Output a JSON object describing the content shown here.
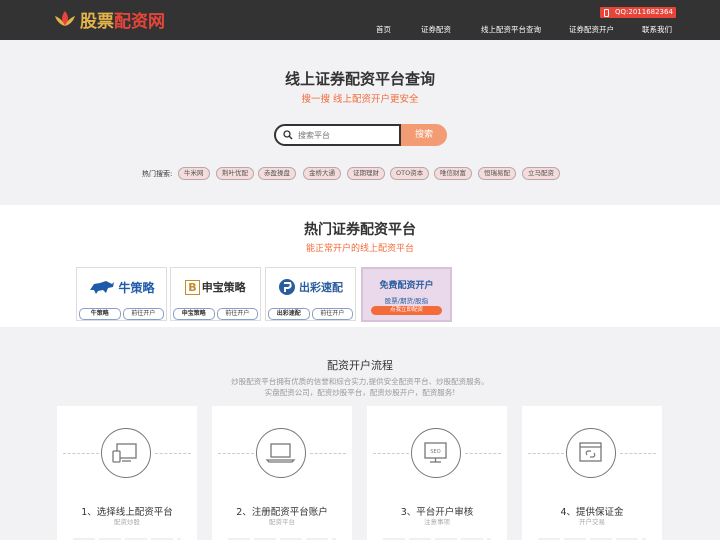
{
  "header": {
    "logo_text_a": "股票",
    "logo_text_b": "配资网",
    "phone": "QQ:2011682364",
    "nav": [
      {
        "label": "首页"
      },
      {
        "label": "证券配资"
      },
      {
        "label": "线上配资平台查询"
      },
      {
        "label": "证券配资开户"
      },
      {
        "label": "联系我们"
      }
    ]
  },
  "hero": {
    "title": "线上证券配资平台查询",
    "subtitle": "搜一搜 线上配资开户更安全",
    "search_placeholder": "搜索平台",
    "search_button": "搜索",
    "hot_label": "热门搜索:",
    "tags": [
      "牛米网",
      "荆叶优配",
      "赤盈操盘",
      "金桥大通",
      "证期理财",
      "OTO资本",
      "唯信财富",
      "恒瑞易配",
      "立马配资"
    ]
  },
  "platforms": {
    "title": "热门证券配资平台",
    "subtitle": "能正常开户的线上配资平台",
    "cards": [
      {
        "logo": "牛策略",
        "name": "牛策略",
        "action": "前往开户",
        "color": "#1e5aa8"
      },
      {
        "logo": "申宝策略",
        "name": "申宝策略",
        "action": "前往开户",
        "color": "#333333"
      },
      {
        "logo": "出彩速配",
        "name": "出彩速配",
        "action": "前往开户",
        "color": "#2a5d9e"
      }
    ],
    "free": {
      "title": "免费配资开户",
      "subtitle": "股票/期货/股指",
      "button": "点我立即配资"
    }
  },
  "process": {
    "title": "配资开户流程",
    "desc_line1": "炒股配资平台拥有优质的信誉和综合实力,提供安全配资平台、炒股配资服务。",
    "desc_line2": "实盘配资公司，配资炒股平台，配资炒股开户，配资服务!",
    "steps": [
      {
        "title": "1、选择线上配资平台",
        "sub": "配资炒股",
        "icon": "devices-icon"
      },
      {
        "title": "2、注册配资平台账户",
        "sub": "配资平台",
        "icon": "laptop-icon"
      },
      {
        "title": "3、平台开户审核",
        "sub": "注意事项",
        "icon": "seo-monitor-icon"
      },
      {
        "title": "4、提供保证金",
        "sub": "开户交易",
        "icon": "browser-link-icon"
      }
    ]
  },
  "colors": {
    "header_bg": "#333333",
    "accent_orange": "#f36b3a",
    "search_button": "#f39c74",
    "brand_red": "#e8453a"
  }
}
